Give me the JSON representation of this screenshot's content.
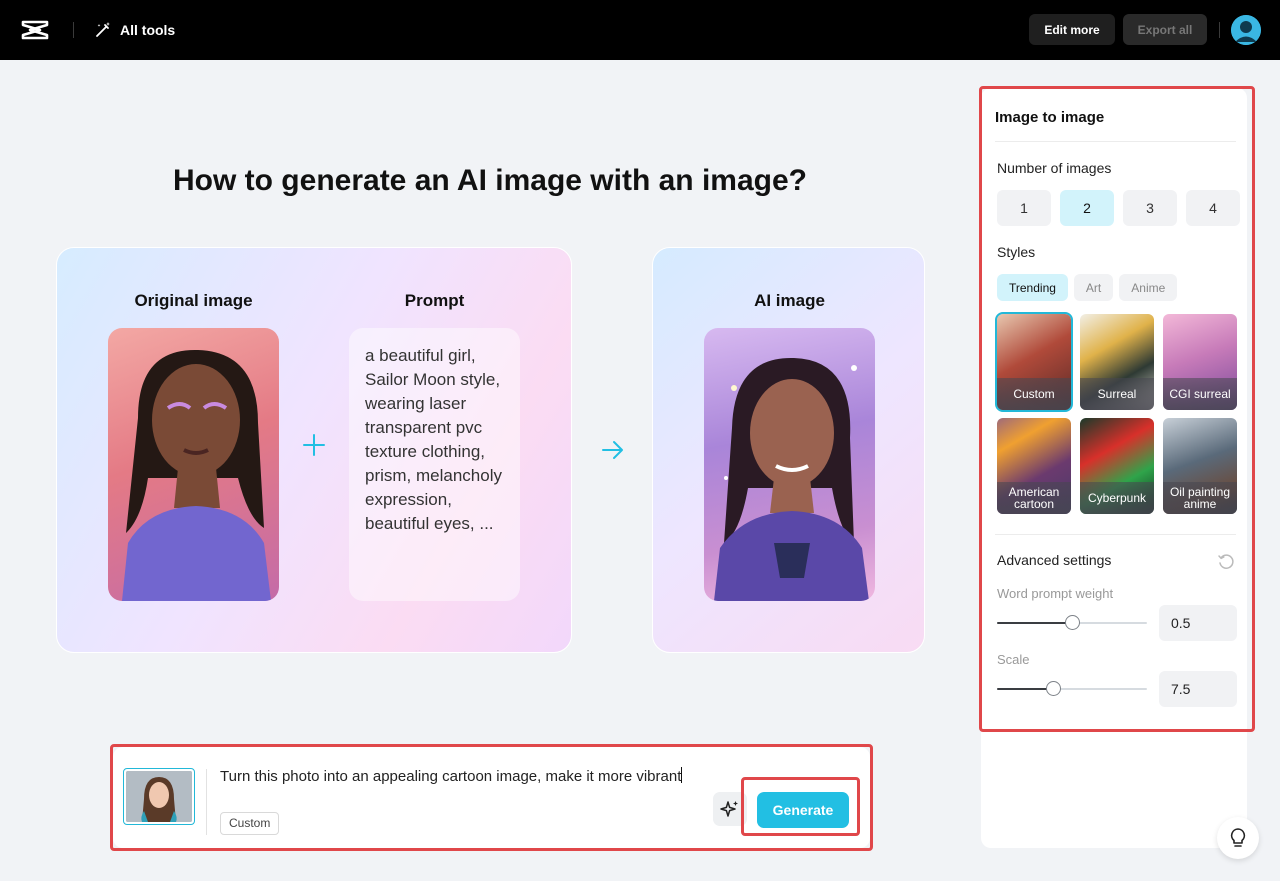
{
  "topbar": {
    "all_tools": "All tools",
    "edit_more": "Edit more",
    "export_all": "Export all"
  },
  "main": {
    "title": "How to generate an AI image with an image?",
    "original_label": "Original image",
    "prompt_label": "Prompt",
    "ai_label": "AI image",
    "prompt_text": "a beautiful girl, Sailor Moon style, wearing laser transparent pvc texture clothing, prism, melancholy expression, beautiful eyes, ..."
  },
  "prompt_bar": {
    "text": "Turn this photo into an appealing cartoon image, make it more vibrant",
    "chip": "Custom",
    "generate": "Generate"
  },
  "panel": {
    "title": "Image to image",
    "number_label": "Number of images",
    "numbers": [
      "1",
      "2",
      "3",
      "4"
    ],
    "selected_number": "2",
    "styles_label": "Styles",
    "style_tabs": [
      "Trending",
      "Art",
      "Anime"
    ],
    "active_tab": "Trending",
    "styles": [
      {
        "label": "Custom",
        "selected": true
      },
      {
        "label": "Surreal",
        "selected": false
      },
      {
        "label": "CGI surreal",
        "selected": false
      },
      {
        "label": "American cartoon",
        "selected": false
      },
      {
        "label": "Cyberpunk",
        "selected": false
      },
      {
        "label": "Oil painting anime",
        "selected": false
      }
    ],
    "advanced_label": "Advanced settings",
    "word_weight_label": "Word prompt weight",
    "word_weight_value": "0.5",
    "word_weight_fraction": 0.5,
    "scale_label": "Scale",
    "scale_value": "7.5",
    "scale_fraction": 0.375
  },
  "icons": {
    "logo": "capcut-logo-icon",
    "all_tools": "magic-wand-icon",
    "plus": "plus-icon",
    "arrow": "arrow-right-icon",
    "magic": "sparkle-icon",
    "reset": "reset-icon",
    "bulb": "lightbulb-icon"
  },
  "colors": {
    "accent": "#22bfe3",
    "highlight": "#e0474a"
  }
}
